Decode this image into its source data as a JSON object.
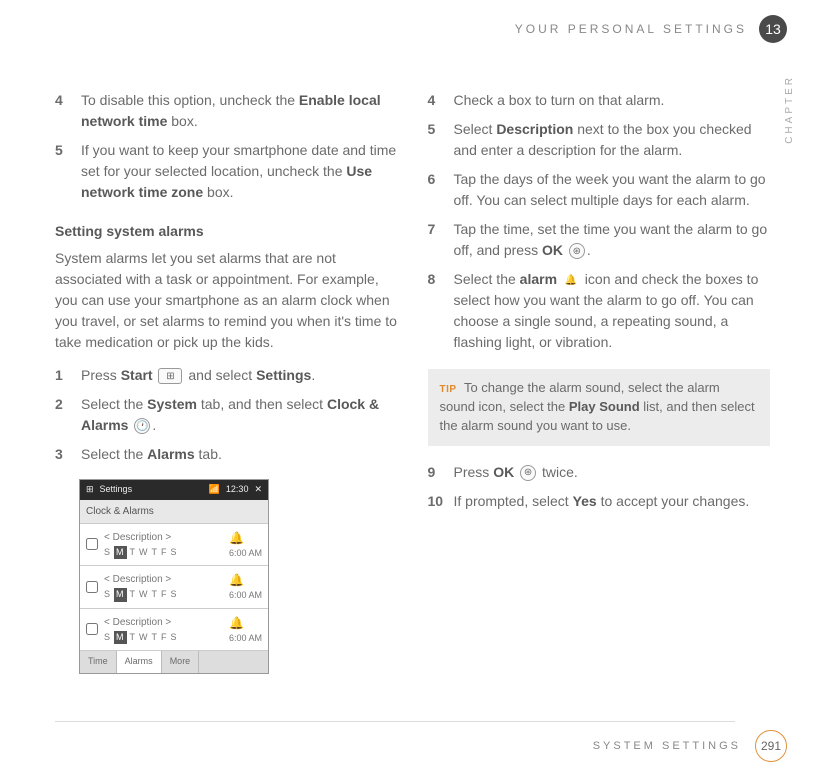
{
  "header": {
    "title": "YOUR PERSONAL SETTINGS",
    "chapter_number": "13",
    "side_label": "CHAPTER"
  },
  "left": {
    "steps_a": [
      {
        "num": "4",
        "parts": [
          "To disable this option, uncheck the ",
          {
            "b": "Enable local network time"
          },
          " box."
        ]
      },
      {
        "num": "5",
        "parts": [
          "If you want to keep your smartphone date and time set for your selected location, uncheck the ",
          {
            "b": "Use network time zone"
          },
          " box."
        ]
      }
    ],
    "subhead": "Setting system alarms",
    "intro": "System alarms let you set alarms that are not associated with a task or appointment. For example, you can use your smartphone as an alarm clock when you travel, or set alarms to remind you when it's time to take medication or pick up the kids.",
    "steps_b": [
      {
        "num": "1",
        "parts": [
          "Press ",
          {
            "b": "Start"
          },
          " ",
          {
            "icon": "start"
          },
          " and select ",
          {
            "b": "Settings"
          },
          "."
        ]
      },
      {
        "num": "2",
        "parts": [
          "Select the ",
          {
            "b": "System"
          },
          " tab, and then select ",
          {
            "b": "Clock & Alarms"
          },
          " ",
          {
            "icon": "clock"
          },
          "."
        ]
      },
      {
        "num": "3",
        "parts": [
          "Select the ",
          {
            "b": "Alarms"
          },
          " tab."
        ]
      }
    ],
    "screenshot": {
      "title": "Settings",
      "time": "12:30",
      "header": "Clock & Alarms",
      "rows": [
        {
          "desc": "< Description >",
          "time": "6:00 AM"
        },
        {
          "desc": "< Description >",
          "time": "6:00 AM"
        },
        {
          "desc": "< Description >",
          "time": "6:00 AM"
        }
      ],
      "days": [
        "S",
        "M",
        "T",
        "W",
        "T",
        "F",
        "S"
      ],
      "tabs": [
        "Time",
        "Alarms",
        "More"
      ]
    }
  },
  "right": {
    "steps": [
      {
        "num": "4",
        "parts": [
          "Check a box to turn on that alarm."
        ]
      },
      {
        "num": "5",
        "parts": [
          "Select ",
          {
            "b": "Description"
          },
          " next to the box you checked and enter a description for the alarm."
        ]
      },
      {
        "num": "6",
        "parts": [
          "Tap the days of the week you want the alarm to go off. You can select multiple days for each alarm."
        ]
      },
      {
        "num": "7",
        "parts": [
          "Tap the time, set the time you want the alarm to go off, and press ",
          {
            "b": "OK"
          },
          " ",
          {
            "icon": "ok"
          },
          "."
        ]
      },
      {
        "num": "8",
        "parts": [
          "Select the ",
          {
            "b": "alarm"
          },
          " ",
          {
            "icon": "bell"
          },
          " icon and check the boxes to select how you want the alarm to go off. You can choose a single sound, a repeating sound, a flashing light, or vibration."
        ]
      }
    ],
    "tip": {
      "label": "TIP",
      "parts": [
        "To change the alarm sound, select the alarm sound icon, select the ",
        {
          "b": "Play Sound"
        },
        " list, and then select the alarm sound you want to use."
      ]
    },
    "steps_after": [
      {
        "num": "9",
        "parts": [
          "Press ",
          {
            "b": "OK"
          },
          " ",
          {
            "icon": "ok"
          },
          " twice."
        ]
      },
      {
        "num": "10",
        "parts": [
          "If prompted, select ",
          {
            "b": "Yes"
          },
          " to accept your changes."
        ]
      }
    ]
  },
  "footer": {
    "title": "SYSTEM SETTINGS",
    "page": "291"
  },
  "icons": {
    "start": "⊞",
    "clock": "🕐",
    "ok": "⊛",
    "bell": "🔔"
  }
}
